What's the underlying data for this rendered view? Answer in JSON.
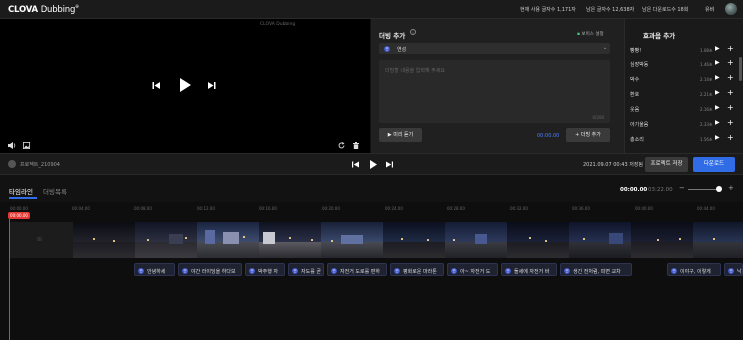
{
  "header": {
    "logo": "CLOVA",
    "logo_sub": "Dubbing",
    "stats": [
      "현재 사용 글자수 1,171자",
      "남은 글자수 12,638자",
      "남은 다운로드수 18회"
    ],
    "user_name": "유비"
  },
  "video": {
    "watermark": "CLOVA Dubbing"
  },
  "dubbing": {
    "title": "더빙 추가",
    "voice_settings": "보이스 설정",
    "selected_voice": "연성",
    "text_placeholder": "더빙할 내용을 입력해 주세요",
    "char_count": "0/200",
    "preview_label": "미리 듣기",
    "time": "00:00.00",
    "add_label": "더빙 추가"
  },
  "effects": {
    "title": "효과음 추가",
    "items": [
      {
        "name": "빵빵!",
        "duration": "1.08초"
      },
      {
        "name": "심장박동",
        "duration": "1.46초"
      },
      {
        "name": "박수",
        "duration": "2.14초"
      },
      {
        "name": "환호",
        "duration": "2.21초"
      },
      {
        "name": "웃음",
        "duration": "2.16초"
      },
      {
        "name": "아기울음",
        "duration": "2.33초"
      },
      {
        "name": "총소리",
        "duration": "1.56초"
      }
    ]
  },
  "controls": {
    "project_name": "프로젝트_210904",
    "save_info": "2021.09.07 00:43 저장됨",
    "save_button": "프로젝트 저장",
    "download_button": "다운로드"
  },
  "timeline": {
    "tab_timeline": "타임라인",
    "tab_dub_list": "더빙목록",
    "current_time": "00:00.00",
    "total_time": "03:22.00",
    "playhead_label": "00:00.00",
    "ticks": [
      "00:00.00",
      "00:04.00",
      "00:08.00",
      "00:12.00",
      "00:16.00",
      "00:20.00",
      "00:24.00",
      "00:28.00",
      "00:32.00",
      "00:36.00",
      "00:40.00",
      "00:44.00"
    ],
    "clips": [
      "안녕하세",
      "야간 라이딩을 하다보",
      "박주행 자",
      "자도를 곧",
      "자전거 도로를 편하",
      "평화로운 마라톤",
      "아~ 자전거 도",
      "돌세에 자전거 바",
      "생긴 전처럼, 피면 교차",
      "이야구, 이렇게",
      "낙"
    ]
  },
  "colors": {
    "accent": "#2f6ce5",
    "playhead": "#e53935",
    "voice_badge": "#3d55c9",
    "voice_settings_dot": "#4cc98a"
  }
}
